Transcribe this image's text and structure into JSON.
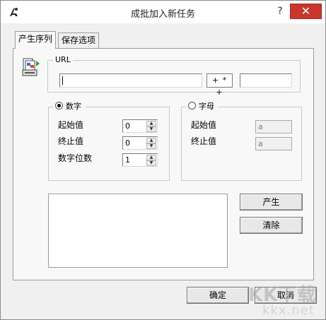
{
  "window": {
    "title": "成批加入新任务",
    "help_label": "?",
    "close_label": "✕"
  },
  "tabs": [
    {
      "label": "产生序列"
    },
    {
      "label": "保存选项"
    }
  ],
  "url_group": {
    "legend": "URL",
    "url_value": "",
    "separator_text": "+ * +",
    "suffix_value": ""
  },
  "number_group": {
    "radio_label": "数字",
    "selected": true,
    "start_label": "起始值",
    "start_value": "0",
    "end_label": "终止值",
    "end_value": "0",
    "digits_label": "数字位数",
    "digits_value": "1"
  },
  "letter_group": {
    "radio_label": "字母",
    "selected": false,
    "start_label": "起始值",
    "start_value": "a",
    "end_label": "终止值",
    "end_value": "a"
  },
  "buttons": {
    "generate": "产生",
    "clear": "清除",
    "ok": "确定",
    "cancel": "取消"
  },
  "watermark": {
    "text": "KK下载",
    "subtext": "kkx.net"
  },
  "colors": {
    "close_button": "#c7372f",
    "window_bg": "#f0f0f0"
  }
}
